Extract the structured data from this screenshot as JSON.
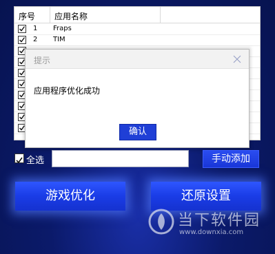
{
  "list": {
    "header_no": "序号",
    "header_name": "应用名称",
    "rows": [
      {
        "no": "1",
        "name": "Fraps",
        "checked": true
      },
      {
        "no": "2",
        "name": "TIM",
        "checked": true
      },
      {
        "no": "",
        "name": "",
        "checked": true
      },
      {
        "no": "",
        "name": "",
        "checked": true
      },
      {
        "no": "",
        "name": "",
        "checked": true
      },
      {
        "no": "",
        "name": "",
        "checked": true
      },
      {
        "no": "",
        "name": "",
        "checked": true
      },
      {
        "no": "",
        "name": "",
        "checked": true
      },
      {
        "no": "",
        "name": "",
        "checked": true
      },
      {
        "no": "",
        "name": "",
        "checked": true
      }
    ]
  },
  "dialog": {
    "title": "提示",
    "message": "应用程序优化成功",
    "ok_label": "确认"
  },
  "controls": {
    "select_all_label": "全选",
    "select_all_checked": true,
    "add_input_value": "",
    "manual_add_label": "手动添加",
    "optimize_label": "游戏优化",
    "restore_label": "还原设置"
  },
  "watermark": {
    "name": "当下软件园",
    "url": "www.downxia.com",
    "icon": "downxia-logo-icon"
  },
  "colors": {
    "accent": "#1f3fd6",
    "background": "#0b1a6a"
  }
}
